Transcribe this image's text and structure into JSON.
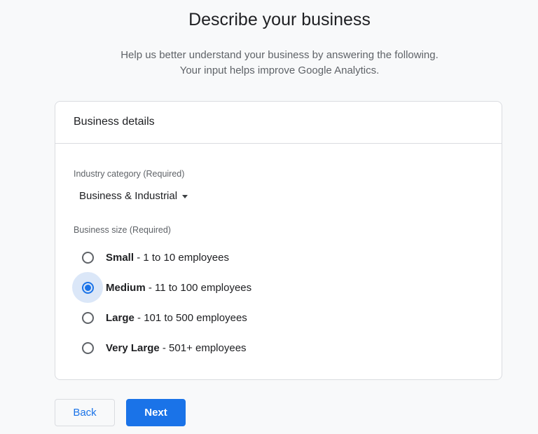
{
  "page": {
    "title": "Describe your business",
    "subtitle_line1": "Help us better understand your business by answering the following.",
    "subtitle_line2": "Your input helps improve Google Analytics."
  },
  "card": {
    "header": "Business details",
    "industry": {
      "label": "Industry category (Required)",
      "selected_value": "Business & Industrial"
    },
    "business_size": {
      "label": "Business size (Required)",
      "options": [
        {
          "name": "Small",
          "detail": " - 1 to 10 employees",
          "checked": false
        },
        {
          "name": "Medium",
          "detail": " - 11 to 100 employees",
          "checked": true
        },
        {
          "name": "Large",
          "detail": " - 101 to 500 employees",
          "checked": false
        },
        {
          "name": "Very Large",
          "detail": " - 501+ employees",
          "checked": false
        }
      ]
    }
  },
  "buttons": {
    "back_label": "Back",
    "next_label": "Next"
  },
  "colors": {
    "accent": "#1a73e8",
    "background": "#f8f9fa",
    "radio_focus_halo": "#dbe7f8"
  }
}
